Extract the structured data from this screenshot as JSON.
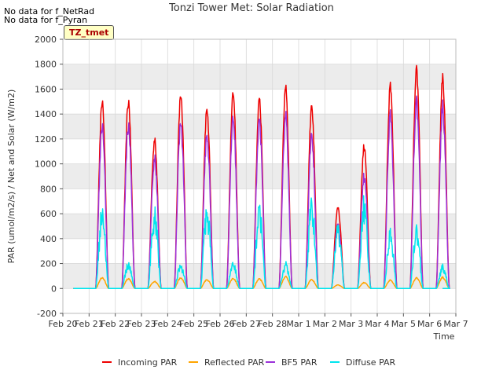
{
  "notes": [
    "No data for f_NetRad",
    "No data for f_Pyran"
  ],
  "badge": "TZ_tmet",
  "chart_data": {
    "type": "line",
    "title": "Tonzi Tower Met: Solar Radiation",
    "xlabel": "Time",
    "ylabel": "PAR (umol/m2/s) / Net and Solar (W/m2)",
    "ylim": [
      -200,
      2000
    ],
    "yticks": [
      -200,
      0,
      200,
      400,
      600,
      800,
      1000,
      1200,
      1400,
      1600,
      1800,
      2000
    ],
    "xlim": [
      0,
      15
    ],
    "xticks": [
      0,
      1,
      2,
      3,
      4,
      5,
      6,
      7,
      8,
      9,
      10,
      11,
      12,
      13,
      14,
      15
    ],
    "xtick_labels": [
      "Feb 20",
      "Feb 21",
      "Feb 22",
      "Feb 23",
      "Feb 24",
      "Feb 25",
      "Feb 26",
      "Feb 27",
      "Feb 28",
      "Mar 1",
      "Mar 2",
      "Mar 3",
      "Mar 4",
      "Mar 5",
      "Mar 6",
      "Mar 7"
    ],
    "grid": true,
    "legend_position": "bottom",
    "daily_peaks": {
      "days": [
        "Feb 21",
        "Feb 22",
        "Feb 23",
        "Feb 24",
        "Feb 25",
        "Feb 26",
        "Feb 27",
        "Feb 28",
        "Mar 1",
        "Mar 2",
        "Mar 3",
        "Mar 4",
        "Mar 5",
        "Mar 6"
      ],
      "series": [
        {
          "name": "Incoming PAR",
          "color": "#ee0000",
          "peaks": [
            1530,
            1550,
            1230,
            1590,
            1480,
            1610,
            1540,
            1650,
            1490,
            660,
            1170,
            1660,
            1800,
            1730
          ]
        },
        {
          "name": "Reflected PAR",
          "color": "#ffa500",
          "peaks": [
            90,
            85,
            60,
            90,
            75,
            85,
            80,
            100,
            75,
            30,
            50,
            70,
            90,
            95
          ]
        },
        {
          "name": "BF5 PAR",
          "color": "#9b30d9",
          "peaks": [
            1350,
            1380,
            1100,
            1390,
            1290,
            1430,
            1380,
            1440,
            1270,
            530,
            940,
            1440,
            1560,
            1520
          ]
        },
        {
          "name": "Diffuse PAR",
          "color": "#00e5ee",
          "peaks": [
            670,
            230,
            700,
            210,
            730,
            230,
            690,
            220,
            760,
            540,
            770,
            490,
            530,
            200
          ]
        }
      ]
    }
  }
}
